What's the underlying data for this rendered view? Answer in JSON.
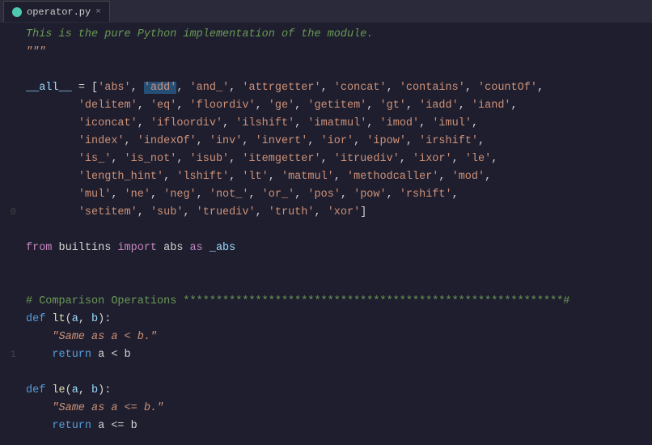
{
  "tab": {
    "filename": "operator.py",
    "close": "×"
  },
  "lines": [
    {
      "num": "",
      "tokens": [
        {
          "text": "This is the pure Python implementation of the module.",
          "class": "c-italic"
        }
      ]
    },
    {
      "num": "",
      "tokens": [
        {
          "text": "\"\"\"",
          "class": "c-docstring"
        }
      ]
    },
    {
      "num": "",
      "tokens": []
    },
    {
      "num": "",
      "tokens": [
        {
          "text": "__all__",
          "class": "c-variable"
        },
        {
          "text": " = [",
          "class": "c-normal"
        },
        {
          "text": "'abs'",
          "class": "c-string"
        },
        {
          "text": ", ",
          "class": "c-normal"
        },
        {
          "text": "'add'",
          "class": "c-string c-highlight"
        },
        {
          "text": ", ",
          "class": "c-normal"
        },
        {
          "text": "'and_'",
          "class": "c-string"
        },
        {
          "text": ", ",
          "class": "c-normal"
        },
        {
          "text": "'attrgetter'",
          "class": "c-string"
        },
        {
          "text": ", ",
          "class": "c-normal"
        },
        {
          "text": "'concat'",
          "class": "c-string"
        },
        {
          "text": ", ",
          "class": "c-normal"
        },
        {
          "text": "'contains'",
          "class": "c-string"
        },
        {
          "text": ", ",
          "class": "c-normal"
        },
        {
          "text": "'countOf'",
          "class": "c-string"
        },
        {
          "text": ",",
          "class": "c-normal"
        }
      ]
    },
    {
      "num": "",
      "tokens": [
        {
          "text": "        ",
          "class": "c-normal"
        },
        {
          "text": "'delitem'",
          "class": "c-string"
        },
        {
          "text": ", ",
          "class": "c-normal"
        },
        {
          "text": "'eq'",
          "class": "c-string"
        },
        {
          "text": ", ",
          "class": "c-normal"
        },
        {
          "text": "'floordiv'",
          "class": "c-string"
        },
        {
          "text": ", ",
          "class": "c-normal"
        },
        {
          "text": "'ge'",
          "class": "c-string"
        },
        {
          "text": ", ",
          "class": "c-normal"
        },
        {
          "text": "'getitem'",
          "class": "c-string"
        },
        {
          "text": ", ",
          "class": "c-normal"
        },
        {
          "text": "'gt'",
          "class": "c-string"
        },
        {
          "text": ", ",
          "class": "c-normal"
        },
        {
          "text": "'iadd'",
          "class": "c-string"
        },
        {
          "text": ", ",
          "class": "c-normal"
        },
        {
          "text": "'iand'",
          "class": "c-string"
        },
        {
          "text": ",",
          "class": "c-normal"
        }
      ]
    },
    {
      "num": "",
      "tokens": [
        {
          "text": "        ",
          "class": "c-normal"
        },
        {
          "text": "'iconcat'",
          "class": "c-string"
        },
        {
          "text": ", ",
          "class": "c-normal"
        },
        {
          "text": "'ifloordiv'",
          "class": "c-string"
        },
        {
          "text": ", ",
          "class": "c-normal"
        },
        {
          "text": "'ilshift'",
          "class": "c-string"
        },
        {
          "text": ", ",
          "class": "c-normal"
        },
        {
          "text": "'imatmul'",
          "class": "c-string"
        },
        {
          "text": ", ",
          "class": "c-normal"
        },
        {
          "text": "'imod'",
          "class": "c-string"
        },
        {
          "text": ", ",
          "class": "c-normal"
        },
        {
          "text": "'imul'",
          "class": "c-string"
        },
        {
          "text": ",",
          "class": "c-normal"
        }
      ]
    },
    {
      "num": "",
      "tokens": [
        {
          "text": "        ",
          "class": "c-normal"
        },
        {
          "text": "'index'",
          "class": "c-string"
        },
        {
          "text": ", ",
          "class": "c-normal"
        },
        {
          "text": "'indexOf'",
          "class": "c-string"
        },
        {
          "text": ", ",
          "class": "c-normal"
        },
        {
          "text": "'inv'",
          "class": "c-string"
        },
        {
          "text": ", ",
          "class": "c-normal"
        },
        {
          "text": "'invert'",
          "class": "c-string"
        },
        {
          "text": ", ",
          "class": "c-normal"
        },
        {
          "text": "'ior'",
          "class": "c-string"
        },
        {
          "text": ", ",
          "class": "c-normal"
        },
        {
          "text": "'ipow'",
          "class": "c-string"
        },
        {
          "text": ", ",
          "class": "c-normal"
        },
        {
          "text": "'irshift'",
          "class": "c-string"
        },
        {
          "text": ",",
          "class": "c-normal"
        }
      ]
    },
    {
      "num": "",
      "tokens": [
        {
          "text": "        ",
          "class": "c-normal"
        },
        {
          "text": "'is_'",
          "class": "c-string"
        },
        {
          "text": ", ",
          "class": "c-normal"
        },
        {
          "text": "'is_not'",
          "class": "c-string"
        },
        {
          "text": ", ",
          "class": "c-normal"
        },
        {
          "text": "'isub'",
          "class": "c-string"
        },
        {
          "text": ", ",
          "class": "c-normal"
        },
        {
          "text": "'itemgetter'",
          "class": "c-string"
        },
        {
          "text": ", ",
          "class": "c-normal"
        },
        {
          "text": "'itruediv'",
          "class": "c-string"
        },
        {
          "text": ", ",
          "class": "c-normal"
        },
        {
          "text": "'ixor'",
          "class": "c-string"
        },
        {
          "text": ", ",
          "class": "c-normal"
        },
        {
          "text": "'le'",
          "class": "c-string"
        },
        {
          "text": ",",
          "class": "c-normal"
        }
      ]
    },
    {
      "num": "",
      "tokens": [
        {
          "text": "        ",
          "class": "c-normal"
        },
        {
          "text": "'length_hint'",
          "class": "c-string"
        },
        {
          "text": ", ",
          "class": "c-normal"
        },
        {
          "text": "'lshift'",
          "class": "c-string"
        },
        {
          "text": ", ",
          "class": "c-normal"
        },
        {
          "text": "'lt'",
          "class": "c-string"
        },
        {
          "text": ", ",
          "class": "c-normal"
        },
        {
          "text": "'matmul'",
          "class": "c-string"
        },
        {
          "text": ", ",
          "class": "c-normal"
        },
        {
          "text": "'methodcaller'",
          "class": "c-string"
        },
        {
          "text": ", ",
          "class": "c-normal"
        },
        {
          "text": "'mod'",
          "class": "c-string"
        },
        {
          "text": ",",
          "class": "c-normal"
        }
      ]
    },
    {
      "num": "",
      "tokens": [
        {
          "text": "        ",
          "class": "c-normal"
        },
        {
          "text": "'mul'",
          "class": "c-string"
        },
        {
          "text": ", ",
          "class": "c-normal"
        },
        {
          "text": "'ne'",
          "class": "c-string"
        },
        {
          "text": ", ",
          "class": "c-normal"
        },
        {
          "text": "'neg'",
          "class": "c-string"
        },
        {
          "text": ", ",
          "class": "c-normal"
        },
        {
          "text": "'not_'",
          "class": "c-string"
        },
        {
          "text": ", ",
          "class": "c-normal"
        },
        {
          "text": "'or_'",
          "class": "c-string"
        },
        {
          "text": ", ",
          "class": "c-normal"
        },
        {
          "text": "'pos'",
          "class": "c-string"
        },
        {
          "text": ", ",
          "class": "c-normal"
        },
        {
          "text": "'pow'",
          "class": "c-string"
        },
        {
          "text": ", ",
          "class": "c-normal"
        },
        {
          "text": "'rshift'",
          "class": "c-string"
        },
        {
          "text": ",",
          "class": "c-normal"
        }
      ]
    },
    {
      "num": "0",
      "tokens": [
        {
          "text": "        ",
          "class": "c-normal"
        },
        {
          "text": "'setitem'",
          "class": "c-string"
        },
        {
          "text": ", ",
          "class": "c-normal"
        },
        {
          "text": "'sub'",
          "class": "c-string"
        },
        {
          "text": ", ",
          "class": "c-normal"
        },
        {
          "text": "'truediv'",
          "class": "c-string"
        },
        {
          "text": ", ",
          "class": "c-normal"
        },
        {
          "text": "'truth'",
          "class": "c-string"
        },
        {
          "text": ", ",
          "class": "c-normal"
        },
        {
          "text": "'xor'",
          "class": "c-string"
        },
        {
          "text": "]",
          "class": "c-normal"
        }
      ]
    },
    {
      "num": "",
      "tokens": []
    },
    {
      "num": "",
      "tokens": [
        {
          "text": "from",
          "class": "c-from"
        },
        {
          "text": " builtins ",
          "class": "c-normal"
        },
        {
          "text": "import",
          "class": "c-import"
        },
        {
          "text": " abs ",
          "class": "c-normal"
        },
        {
          "text": "as",
          "class": "c-import"
        },
        {
          "text": " _abs",
          "class": "c-variable"
        }
      ]
    },
    {
      "num": "",
      "tokens": []
    },
    {
      "num": "",
      "tokens": []
    },
    {
      "num": "",
      "tokens": [
        {
          "text": "# Comparison Operations **********************************************************#",
          "class": "c-comment"
        }
      ]
    },
    {
      "num": "",
      "tokens": [
        {
          "text": "def ",
          "class": "c-keyword"
        },
        {
          "text": "lt",
          "class": "c-funcname"
        },
        {
          "text": "(",
          "class": "c-normal"
        },
        {
          "text": "a",
          "class": "c-param"
        },
        {
          "text": ", ",
          "class": "c-normal"
        },
        {
          "text": "b",
          "class": "c-param"
        },
        {
          "text": "):",
          "class": "c-normal"
        }
      ]
    },
    {
      "num": "",
      "tokens": [
        {
          "text": "    ",
          "class": "c-normal"
        },
        {
          "text": "\"Same as a < b.\"",
          "class": "c-docstring"
        }
      ]
    },
    {
      "num": "1",
      "tokens": [
        {
          "text": "    ",
          "class": "c-normal"
        },
        {
          "text": "return",
          "class": "c-keyword"
        },
        {
          "text": " a < b",
          "class": "c-normal"
        }
      ]
    },
    {
      "num": "",
      "tokens": []
    },
    {
      "num": "",
      "tokens": [
        {
          "text": "def ",
          "class": "c-keyword"
        },
        {
          "text": "le",
          "class": "c-funcname"
        },
        {
          "text": "(",
          "class": "c-normal"
        },
        {
          "text": "a",
          "class": "c-param"
        },
        {
          "text": ", ",
          "class": "c-normal"
        },
        {
          "text": "b",
          "class": "c-param"
        },
        {
          "text": "):",
          "class": "c-normal"
        }
      ]
    },
    {
      "num": "",
      "tokens": [
        {
          "text": "    ",
          "class": "c-normal"
        },
        {
          "text": "\"Same as a <= b.\"",
          "class": "c-docstring"
        }
      ]
    },
    {
      "num": "",
      "tokens": [
        {
          "text": "    ",
          "class": "c-normal"
        },
        {
          "text": "return",
          "class": "c-keyword"
        },
        {
          "text": " a <= b",
          "class": "c-normal"
        }
      ]
    }
  ]
}
